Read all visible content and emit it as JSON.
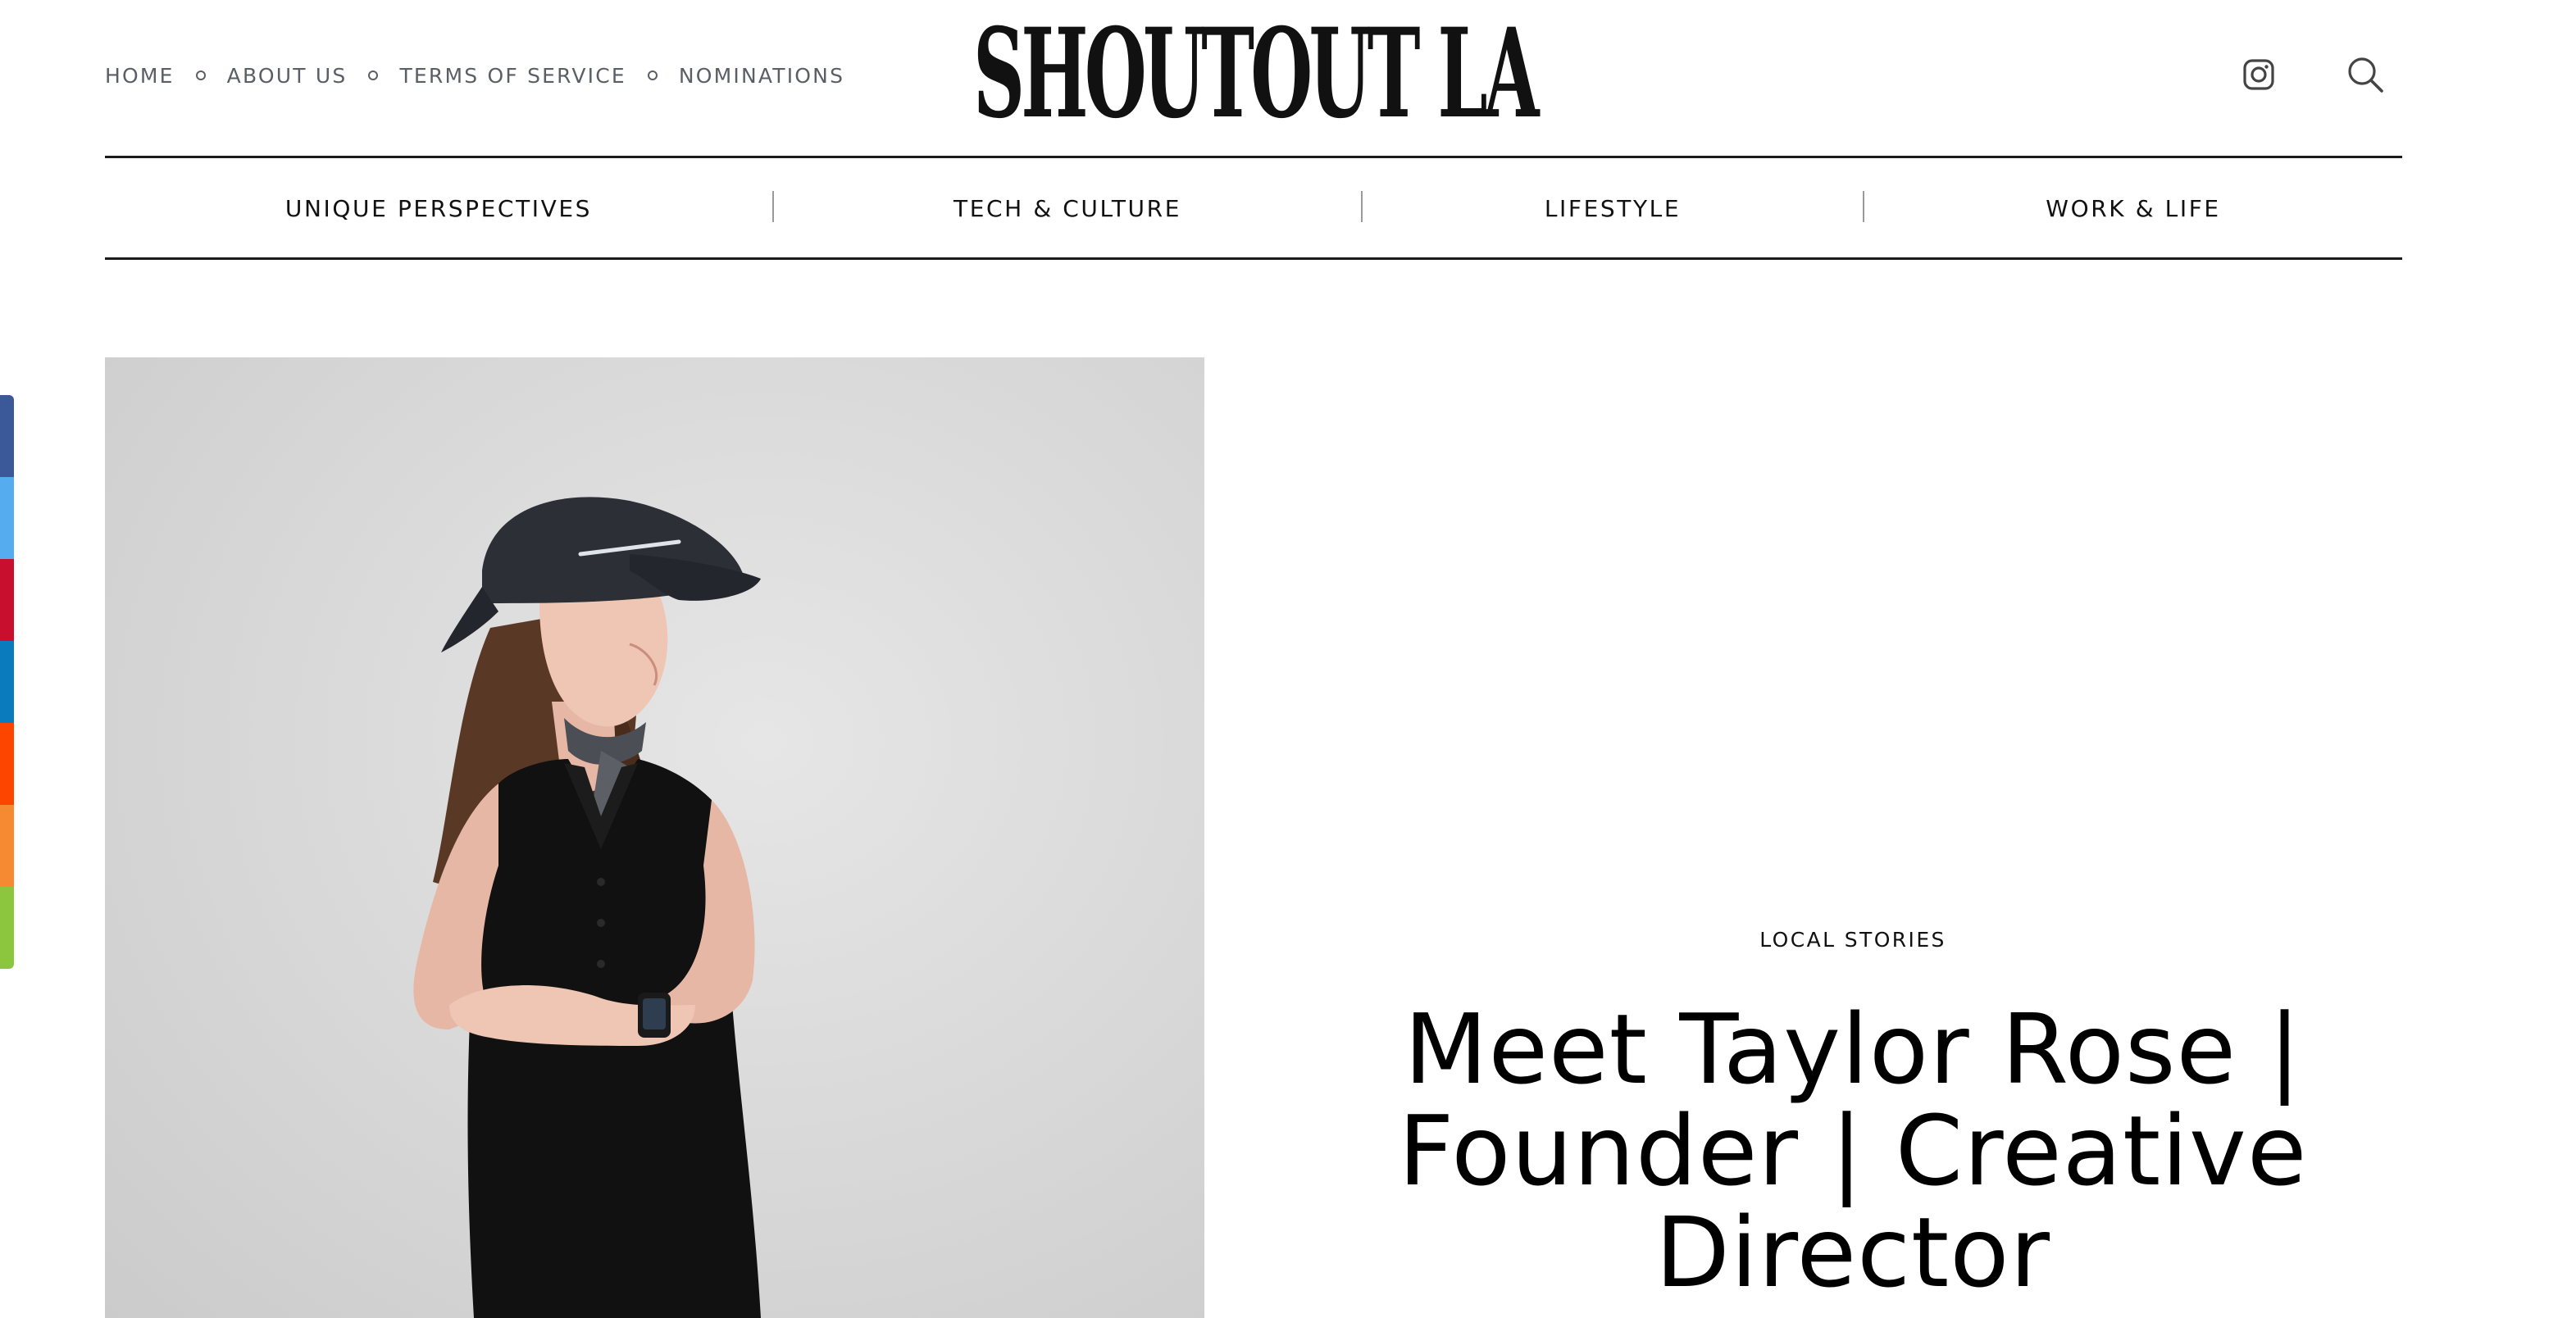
{
  "site": {
    "logo_text": "SHOUTOUT LA"
  },
  "top_nav": {
    "items": [
      {
        "label": "HOME"
      },
      {
        "label": "ABOUT US"
      },
      {
        "label": "TERMS OF SERVICE"
      },
      {
        "label": "NOMINATIONS"
      }
    ]
  },
  "header_icons": [
    "instagram-icon",
    "search-icon"
  ],
  "category_nav": {
    "items": [
      {
        "label": "UNIQUE PERSPECTIVES"
      },
      {
        "label": "TECH & CULTURE"
      },
      {
        "label": "LIFESTYLE"
      },
      {
        "label": "WORK & LIFE"
      }
    ]
  },
  "share_bar": {
    "colors": [
      "#3b5998",
      "#55acee",
      "#c8102e",
      "#0a7bbd",
      "#fe4500",
      "#f68a33",
      "#8cc63f"
    ]
  },
  "article": {
    "category": "LOCAL STORIES",
    "headline": "Meet Taylor Rose | Founder | Creative Director"
  }
}
